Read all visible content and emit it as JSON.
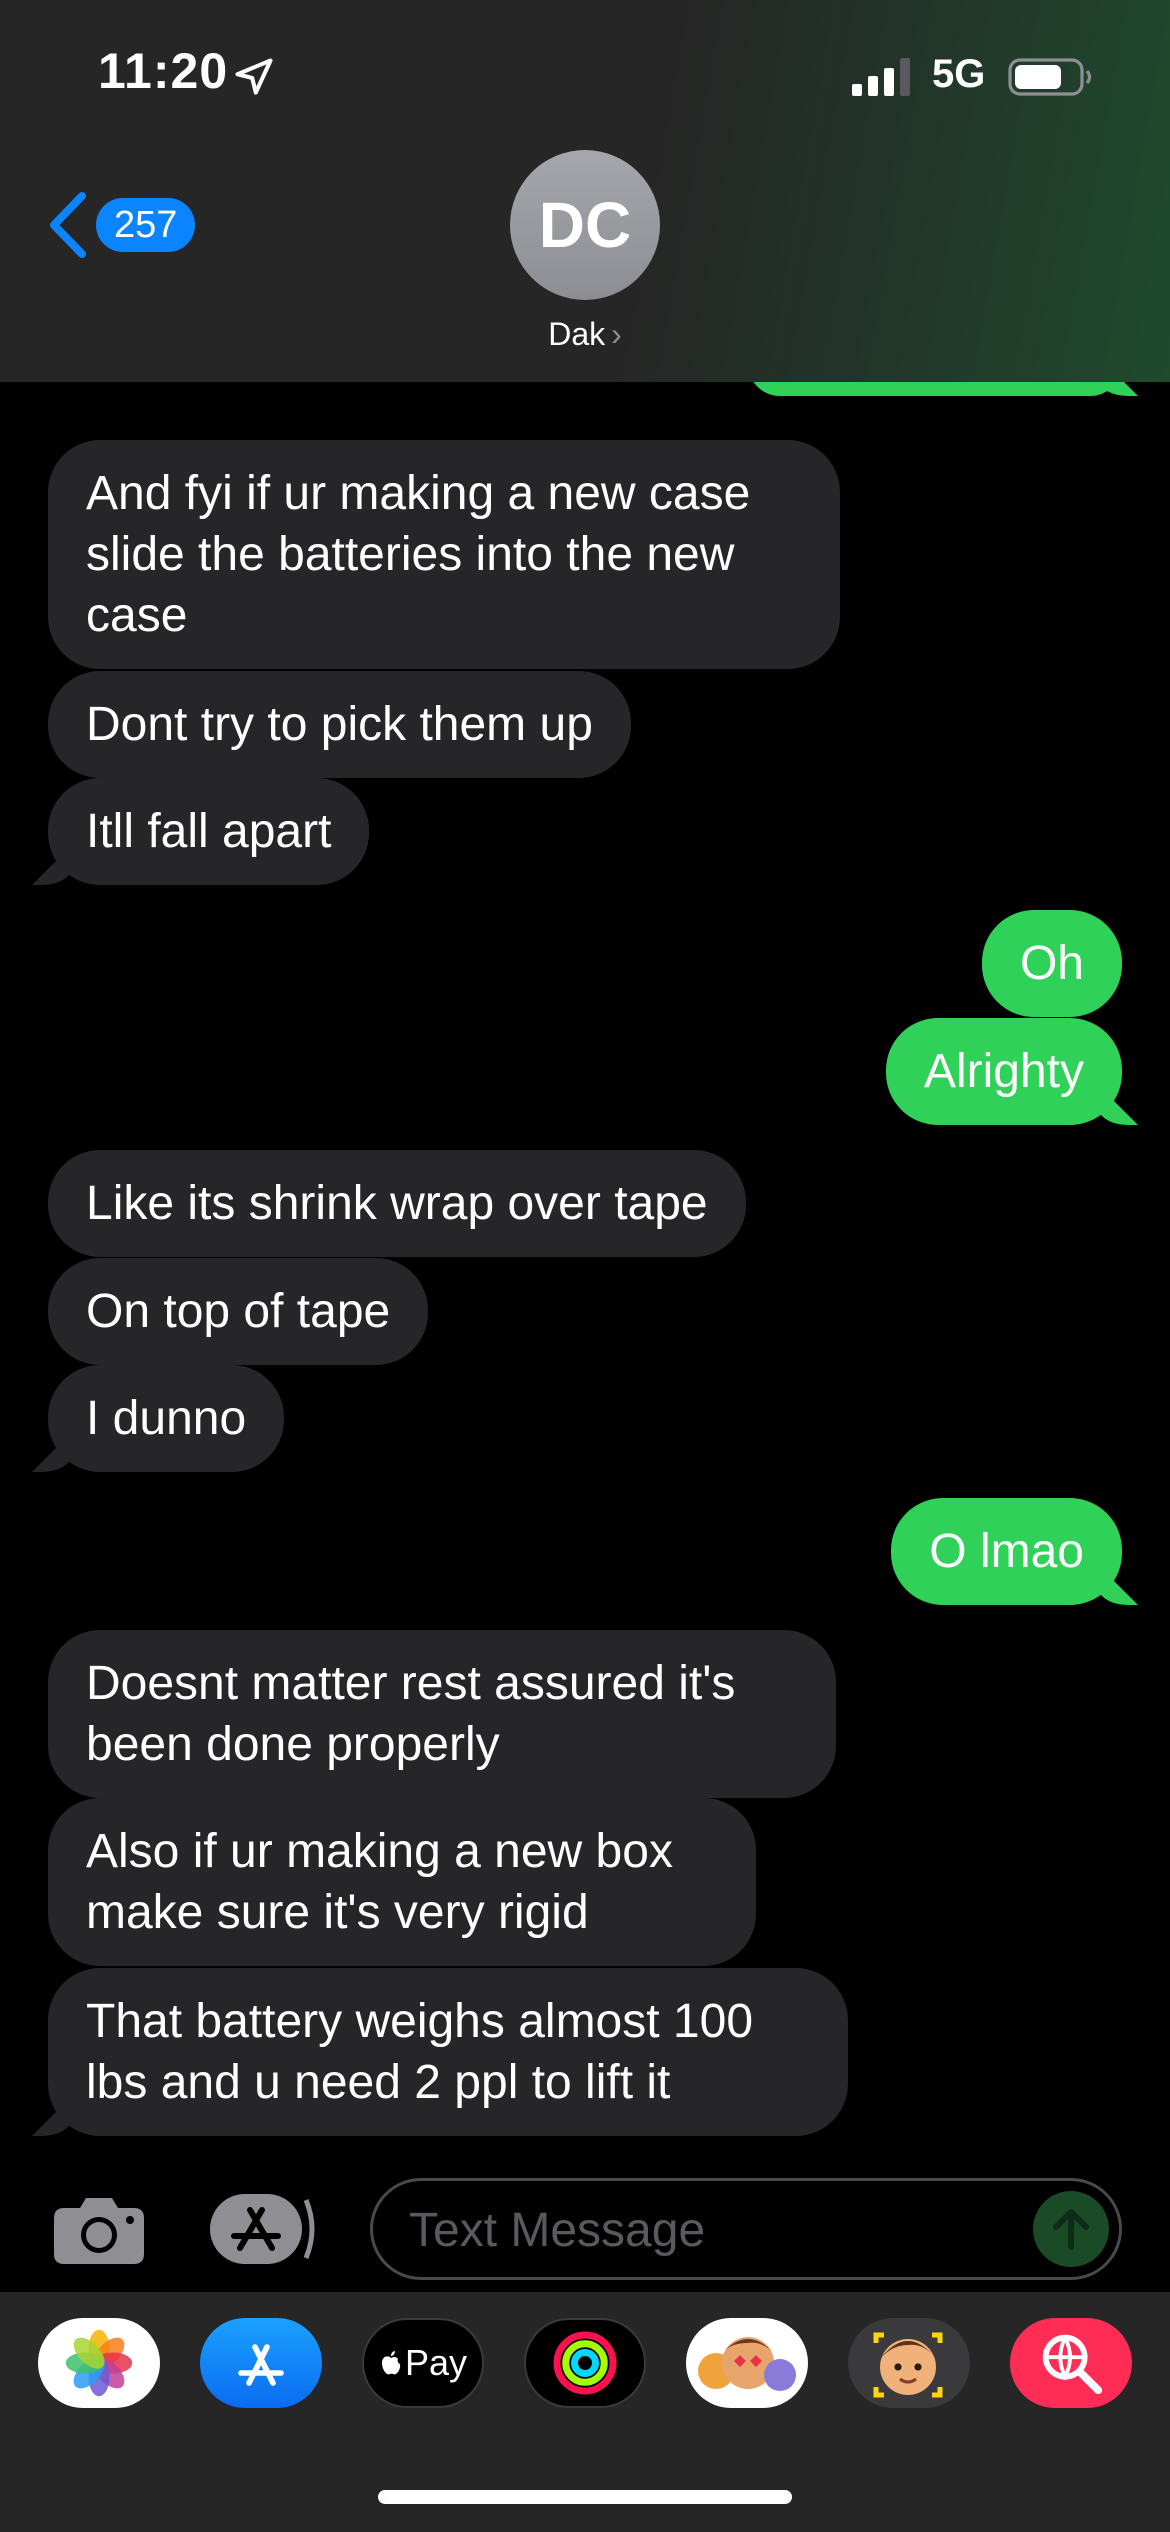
{
  "status_bar": {
    "time": "11:20",
    "network": "5G"
  },
  "header": {
    "back_count": "257",
    "avatar_initials": "DC",
    "contact_name": "Dak",
    "contact_chevron": "›"
  },
  "messages": [
    {
      "dir": "in",
      "text": "And fyi if ur making a new case slide the batteries into the new case"
    },
    {
      "dir": "in",
      "text": "Dont try to pick them up"
    },
    {
      "dir": "in",
      "text": "Itll fall apart"
    },
    {
      "dir": "out",
      "text": "Oh"
    },
    {
      "dir": "out",
      "text": "Alrighty"
    },
    {
      "dir": "in",
      "text": "Like its shrink wrap over tape"
    },
    {
      "dir": "in",
      "text": "On top of tape"
    },
    {
      "dir": "in",
      "text": "I dunno"
    },
    {
      "dir": "out",
      "text": "O lmao"
    },
    {
      "dir": "in",
      "text": "Doesnt matter rest assured it's been done properly"
    },
    {
      "dir": "in",
      "text": "Also if ur making a new box make sure it's very rigid"
    },
    {
      "dir": "in",
      "text": "That battery weighs almost 100 lbs and u need 2 ppl to lift it"
    }
  ],
  "composer": {
    "placeholder": "Text Message"
  },
  "app_drawer": {
    "apps": [
      {
        "name": "photos-icon"
      },
      {
        "name": "app-store-icon"
      },
      {
        "name": "apple-pay-icon",
        "label": "Pay"
      },
      {
        "name": "activity-icon"
      },
      {
        "name": "memoji-stickers-icon"
      },
      {
        "name": "memoji-icon"
      },
      {
        "name": "images-search-icon"
      }
    ]
  },
  "colors": {
    "outgoing": "#30d158",
    "incoming": "#262628",
    "accent": "#0a84ff"
  }
}
